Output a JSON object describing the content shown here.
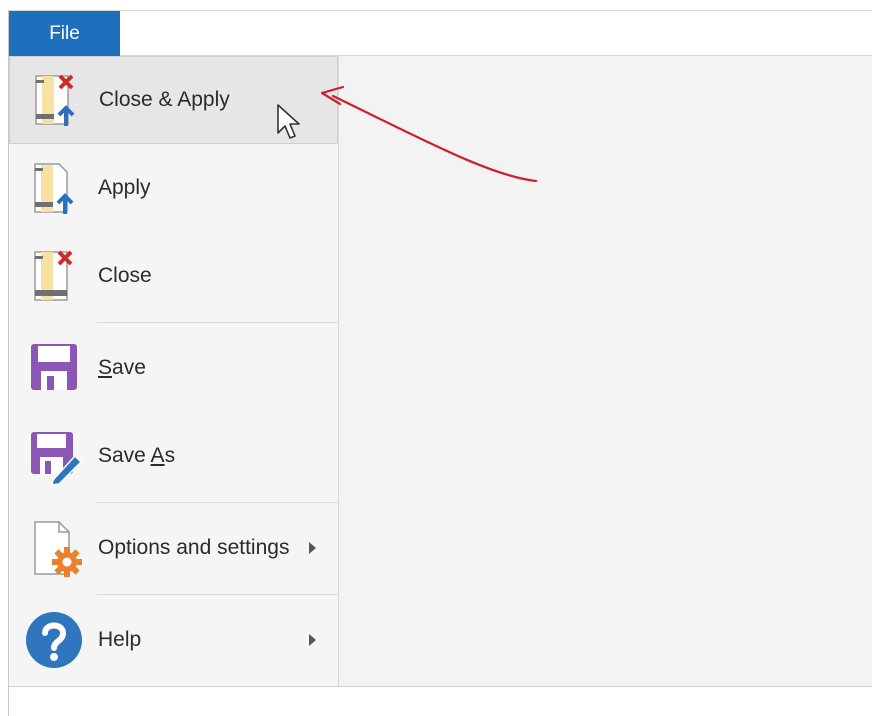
{
  "topbar": {
    "file_tab": "File"
  },
  "menu": {
    "items": [
      {
        "label": "Close & Apply",
        "icon": "close-apply-icon"
      },
      {
        "label": "Apply",
        "icon": "apply-icon"
      },
      {
        "label": "Close",
        "icon": "close-icon"
      },
      {
        "label_parts": [
          "",
          "S",
          "ave"
        ],
        "icon": "save-icon"
      },
      {
        "label_parts": [
          "Save ",
          "A",
          "s"
        ],
        "icon": "save-as-icon"
      },
      {
        "label": "Options and settings",
        "icon": "gear-icon",
        "has_submenu": true
      },
      {
        "label": "Help",
        "icon": "help-icon",
        "has_submenu": true
      }
    ]
  },
  "colors": {
    "file_tab": "#1e6fbc",
    "annotation_arrow": "#cc1f2d",
    "save_purple": "#8a57b5",
    "help_blue": "#2f76bf",
    "gear_orange": "#e9822b"
  }
}
